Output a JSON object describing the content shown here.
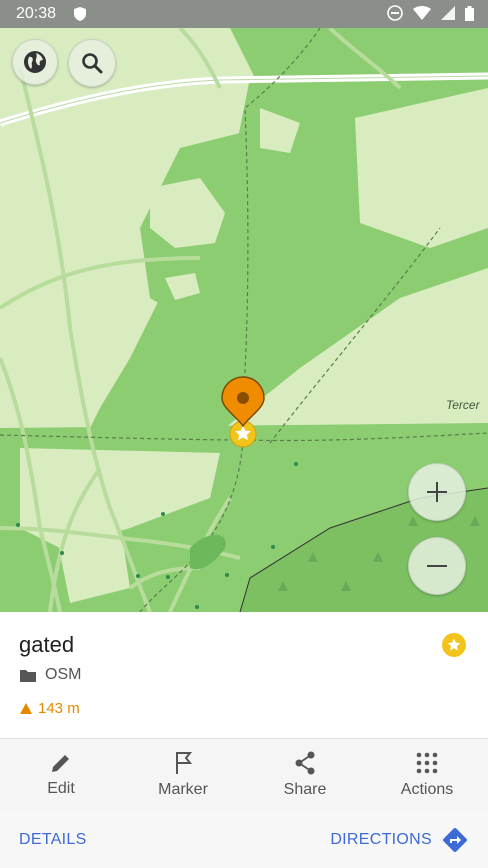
{
  "status_bar": {
    "time": "20:38"
  },
  "map": {
    "street_label": "Tercer"
  },
  "place": {
    "name": "gated",
    "folder": "OSM",
    "distance": "143 m"
  },
  "actions": [
    {
      "label": "Edit",
      "icon": "pencil-icon"
    },
    {
      "label": "Marker",
      "icon": "flag-icon"
    },
    {
      "label": "Share",
      "icon": "share-icon"
    },
    {
      "label": "Actions",
      "icon": "grid-icon"
    }
  ],
  "bottom": {
    "details_label": "DETAILS",
    "directions_label": "DIRECTIONS"
  },
  "colors": {
    "accent": "#3d6ad6",
    "marker": "#f08c00",
    "favorite": "#f2c31a",
    "forest": "#8ccd72",
    "park": "#d9ecc0"
  }
}
